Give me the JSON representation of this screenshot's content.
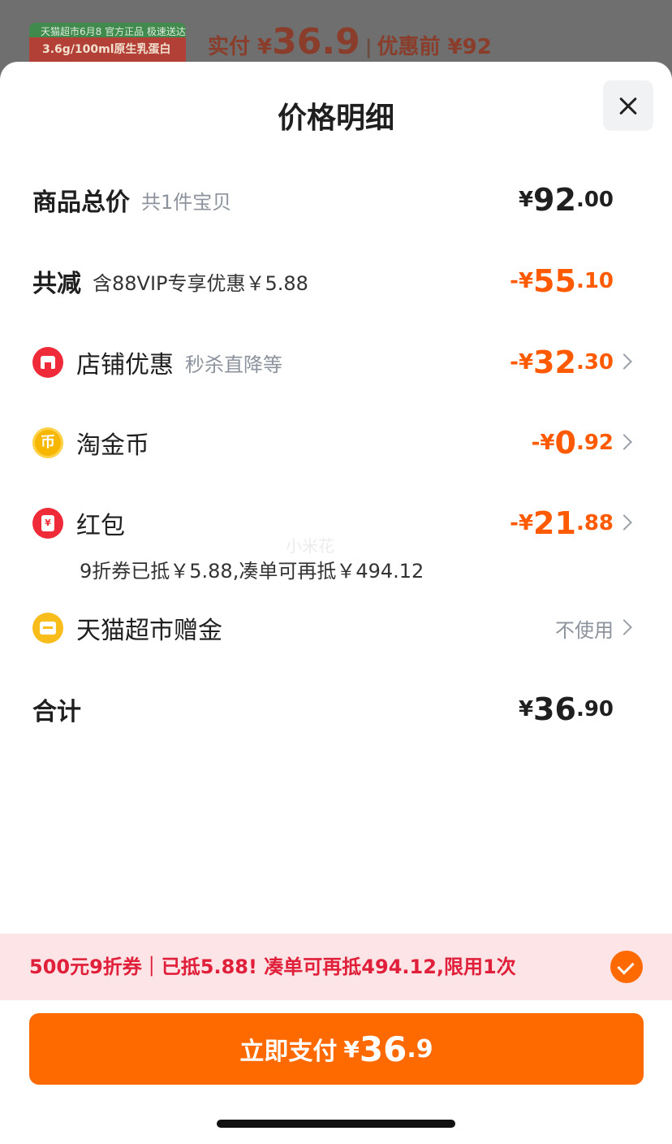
{
  "background": {
    "thumb_line1": "天猫超市6月8 官方正品 极速送达",
    "thumb_line2": "3.6g/100ml原生乳蛋白",
    "price_label": "实付 ¥",
    "price_value": "36.9",
    "before_label": "优惠前 ¥92"
  },
  "sheet": {
    "title": "价格明细"
  },
  "rows": {
    "total": {
      "label": "商品总价",
      "sub": "共1件宝贝",
      "yen": "¥",
      "int": "92",
      "dec": ".00"
    },
    "discount": {
      "label": "共减",
      "sub": "含88VIP专享优惠￥5.88",
      "yen": "-¥",
      "int": "55",
      "dec": ".10"
    },
    "store": {
      "label": "店铺优惠",
      "sub": "秒杀直降等",
      "yen": "-¥",
      "int": "32",
      "dec": ".30"
    },
    "coin": {
      "label": "淘金币",
      "icon_char": "币",
      "yen": "-¥",
      "int": "0",
      "dec": ".92"
    },
    "redpack": {
      "label": "红包",
      "icon_char": "¥",
      "yen": "-¥",
      "int": "21",
      "dec": ".88",
      "note": "9折券已抵￥5.88,凑单可再抵￥494.12"
    },
    "gift": {
      "label": "天猫超市赠金",
      "value": "不使用"
    },
    "sum": {
      "label": "合计",
      "yen": "¥",
      "int": "36",
      "dec": ".90"
    }
  },
  "watermark": "小米花",
  "coupon": {
    "text": "500元9折券｜已抵5.88! 凑单可再抵494.12,限用1次"
  },
  "pay": {
    "label": "立即支付",
    "yen": "¥",
    "int": "36",
    "dec": ".9"
  },
  "colors": {
    "accent": "#ff6a00",
    "discount": "#ff5a00",
    "coupon_bg": "#fde4e6",
    "coupon_text": "#e0203a"
  }
}
